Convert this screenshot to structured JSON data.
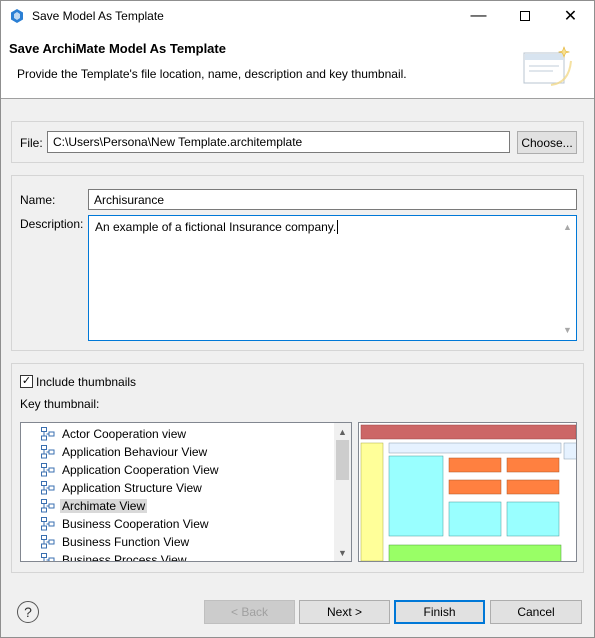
{
  "window": {
    "title": "Save Model As Template",
    "minimize": "—",
    "close": "✕"
  },
  "banner": {
    "title": "Save ArchiMate Model As Template",
    "description": "Provide the Template's file location, name, description and key thumbnail."
  },
  "file": {
    "label": "File:",
    "value": "C:\\Users\\Persona\\New Template.architemplate",
    "choose_label": "Choose..."
  },
  "meta": {
    "name_label": "Name:",
    "name_value": "Archisurance",
    "description_label": "Description:",
    "description_value": "An example of a fictional Insurance company."
  },
  "thumbnails": {
    "include_label": "Include thumbnails",
    "include_checked": true,
    "key_label": "Key thumbnail:",
    "views": [
      "Actor Cooperation view",
      "Application Behaviour View",
      "Application Cooperation View",
      "Application Structure View",
      "Archimate View",
      "Business Cooperation View",
      "Business Function View",
      "Business Process View"
    ],
    "selected_index": 4
  },
  "footer": {
    "back_label": "< Back",
    "next_label": "Next >",
    "finish_label": "Finish",
    "cancel_label": "Cancel"
  },
  "colors": {
    "accent": "#0078d7",
    "business": "#ffff99",
    "application": "#99ffff",
    "technology": "#99ff66",
    "highlight": "#ff8040"
  }
}
